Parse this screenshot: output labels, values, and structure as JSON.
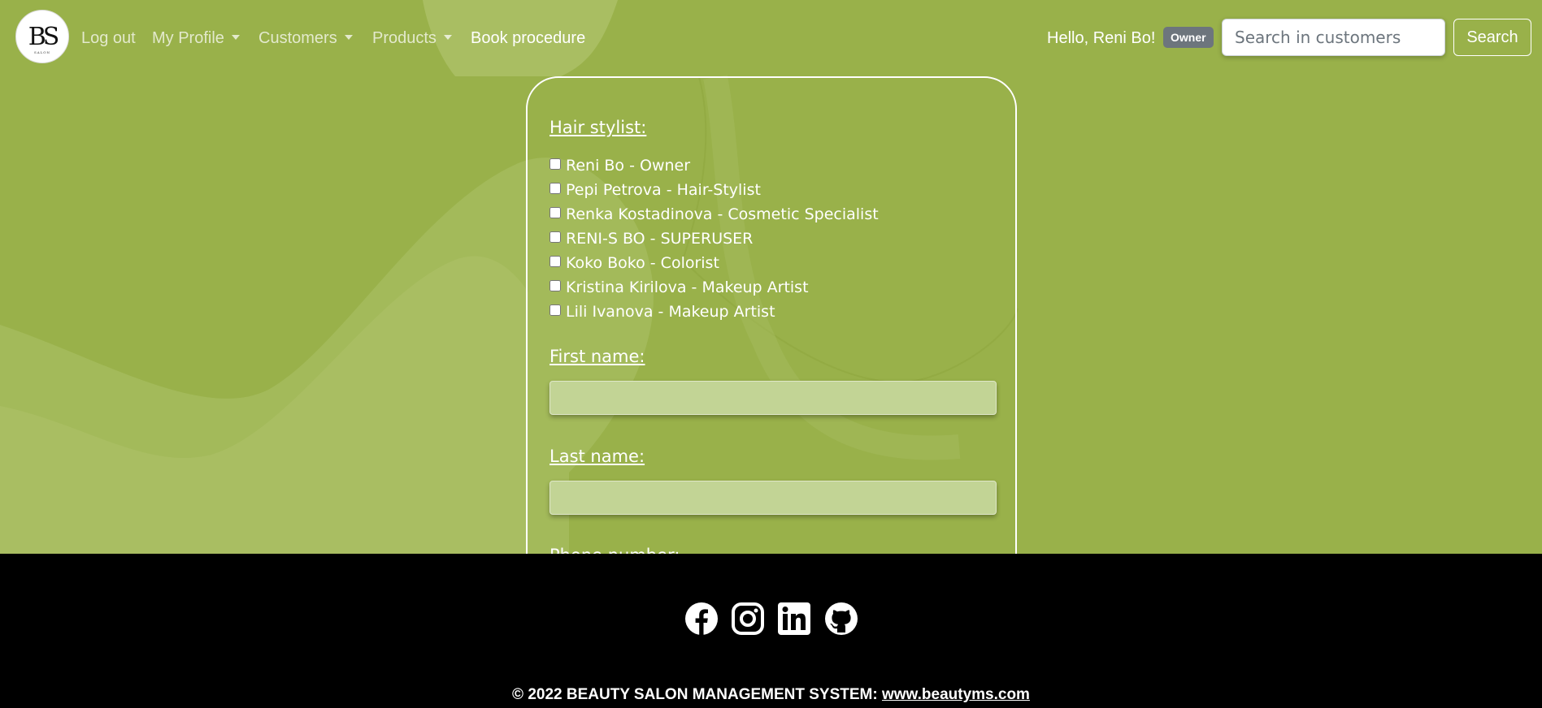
{
  "navbar": {
    "logo_text": "BS",
    "logo_subtext": "SALON",
    "links": [
      {
        "label": "Log out"
      },
      {
        "label": "My Profile"
      },
      {
        "label": "Customers"
      },
      {
        "label": "Products"
      },
      {
        "label": "Book procedure"
      }
    ],
    "greeting": "Hello, Reni Bo!",
    "role_badge": "Owner",
    "search_placeholder": "Search in customers",
    "search_button": "Search"
  },
  "form": {
    "hair_stylist_label": "Hair stylist:",
    "stylists": [
      {
        "label": "Reni Bo - Owner",
        "checked": false
      },
      {
        "label": "Pepi Petrova - Hair-Stylist",
        "checked": false
      },
      {
        "label": "Renka Kostadinova - Cosmetic Specialist",
        "checked": false
      },
      {
        "label": "RENI-S BO - SUPERUSER",
        "checked": false
      },
      {
        "label": "Koko Boko - Colorist",
        "checked": false
      },
      {
        "label": "Kristina Kirilova - Makeup Artist",
        "checked": false
      },
      {
        "label": "Lili Ivanova - Makeup Artist",
        "checked": false
      }
    ],
    "first_name_label": "First name:",
    "first_name_value": "",
    "last_name_label": "Last name:",
    "last_name_value": "",
    "phone_label": "Phone number:"
  },
  "footer": {
    "social_icons": [
      "facebook-icon",
      "instagram-icon",
      "linkedin-icon",
      "github-icon"
    ],
    "copyright_text": "© 2022 BEAUTY SALON MANAGEMENT SYSTEM: ",
    "website_link": "www.beautyms.com"
  },
  "colors": {
    "background": "#99b14a",
    "footer": "#000000",
    "badge": "#6d757d",
    "input_fill": "#c2d495"
  }
}
